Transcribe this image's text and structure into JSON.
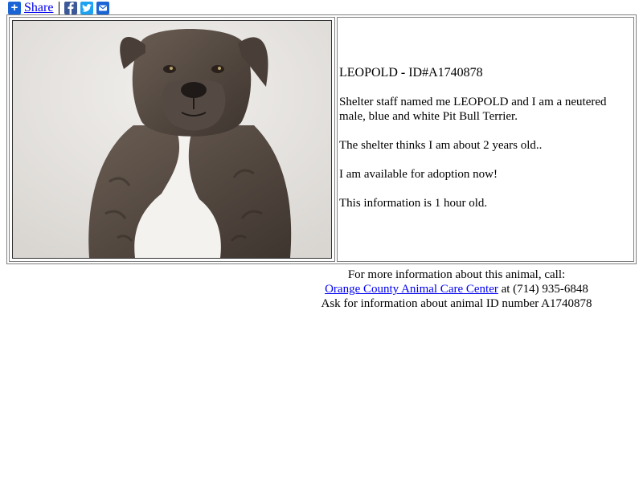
{
  "share": {
    "label": "Share",
    "icons": [
      "share-plus-icon",
      "facebook-icon",
      "twitter-icon",
      "email-icon"
    ],
    "colors": {
      "plus": "#1a64d6",
      "facebook": "#3b5998",
      "twitter": "#1da1f2",
      "email": "#1a64d6"
    }
  },
  "animal": {
    "name": "LEOPOLD",
    "separator": " - ",
    "id_label": "ID#A1740878",
    "description": "Shelter staff named me LEOPOLD and I am a neutered male, blue and white Pit Bull Terrier.",
    "age_text": "The shelter thinks I am about 2 years old..",
    "availability": "I am available for adoption now!",
    "freshness": "This information is 1 hour old.",
    "photo_alt": "dog-photo"
  },
  "footer": {
    "line1": "For more information about this animal, call:",
    "center_link": "Orange County Animal Care Center",
    "phone": " at (714) 935-6848",
    "line3": "Ask for information about animal ID number A1740878"
  }
}
